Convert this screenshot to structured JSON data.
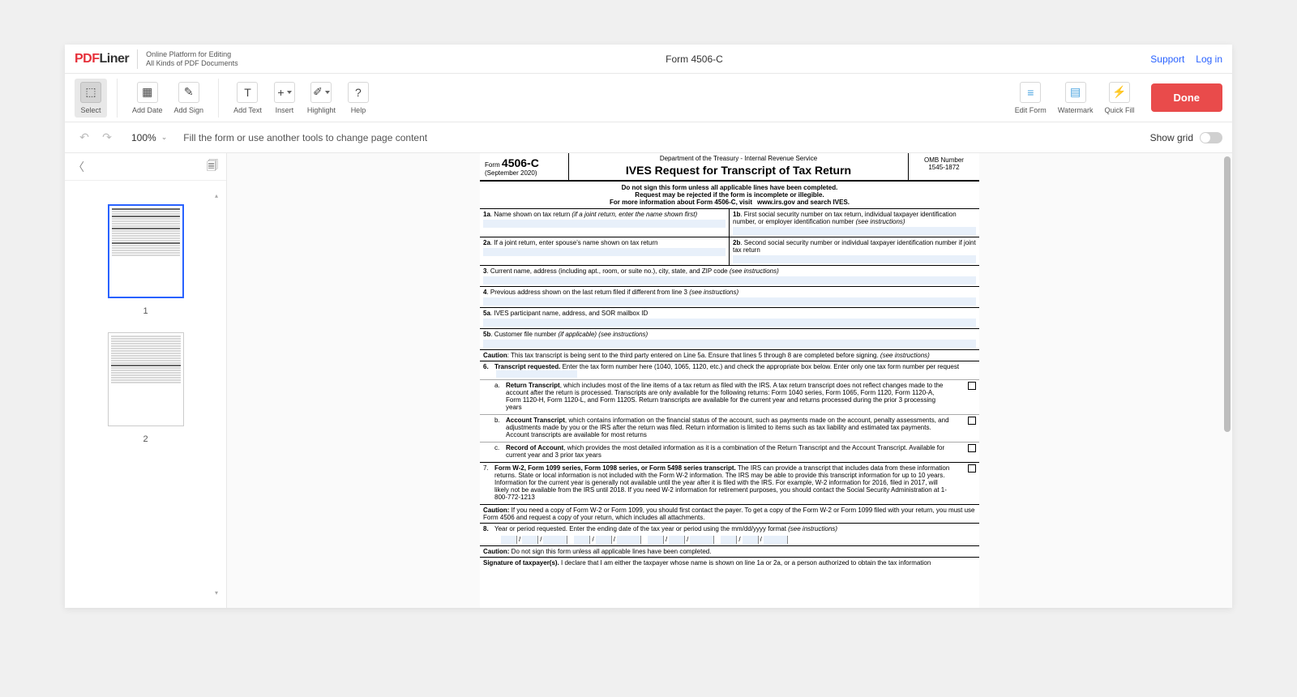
{
  "header": {
    "logo_pdf": "PDF",
    "logo_liner": "Liner",
    "tagline1": "Online Platform for Editing",
    "tagline2": "All Kinds of PDF Documents",
    "doc_title": "Form 4506-C",
    "support": "Support",
    "login": "Log in"
  },
  "toolbar": {
    "select": "Select",
    "add_date": "Add Date",
    "add_sign": "Add Sign",
    "add_text": "Add Text",
    "insert": "Insert",
    "highlight": "Highlight",
    "help": "Help",
    "edit_form": "Edit Form",
    "watermark": "Watermark",
    "quick_fill": "Quick Fill",
    "done": "Done"
  },
  "subbar": {
    "zoom": "100%",
    "hint": "Fill the form or use another tools to change page content",
    "show_grid": "Show grid"
  },
  "thumbs": {
    "page1": "1",
    "page2": "2"
  },
  "form": {
    "form_label": "Form",
    "form_number": "4506-C",
    "form_date": "(September 2020)",
    "dept": "Department of the Treasury - Internal Revenue Service",
    "title": "IVES Request for Transcript of Tax Return",
    "omb_label": "OMB Number",
    "omb_number": "1545-1872",
    "warn1": "Do not sign this form unless all applicable lines have been completed.",
    "warn2": "Request may be rejected if the form is incomplete or illegible.",
    "warn3_a": "For more information about Form 4506-C, visit",
    "warn3_b": "www.irs.gov and search IVES.",
    "row1a_label": "1a",
    "row1a_text": ". Name shown on tax return ",
    "row1a_italic": "(if a joint return, enter the name shown first)",
    "row1b_label": "1b",
    "row1b_text": ". First social security number on tax return, individual taxpayer identification number, or employer identification number ",
    "row1b_italic": "(see instructions)",
    "row2a_label": "2a",
    "row2a_text": ". If a joint return, enter spouse's name shown on tax return",
    "row2b_label": "2b",
    "row2b_text": ". Second social security number or individual taxpayer identification number if joint tax return",
    "row3_label": "3",
    "row3_text": ". Current name, address (including apt., room, or suite no.), city, state, and ZIP code ",
    "row3_italic": "(see instructions)",
    "row4_label": "4",
    "row4_text": ". Previous address shown on the last return filed if different from line 3 ",
    "row4_italic": "(see instructions)",
    "row5a_label": "5a",
    "row5a_text": ". IVES participant name, address, and SOR mailbox ID",
    "row5b_label": "5b",
    "row5b_text": ". Customer file number ",
    "row5b_italic": "(if applicable) (see instructions)",
    "caution1_label": "Caution",
    "caution1_text": ": This tax transcript is being sent to the third party entered on Line 5a. Ensure that lines 5 through 8 are completed before signing. ",
    "caution1_italic": "(see instructions)",
    "row6_num": "6.",
    "row6_bold": "Transcript requested.",
    "row6_text1": " Enter the tax form number here (1040, 1065, 1120, etc.) and check the appropriate box below. Enter only one tax form number per request",
    "row6a_letter": "a.",
    "row6a_bold": "Return Transcript",
    "row6a_text": ", which includes most of the line items of a tax return as filed with the IRS. A tax return transcript does not reflect changes made to the account after the return is processed. Transcripts are only available for the following returns: Form 1040 series, Form 1065, Form 1120, Form 1120-A, Form 1120-H, Form 1120-L, and Form 1120S. Return transcripts are available for the current year and returns processed during the prior 3 processing years",
    "row6b_letter": "b.",
    "row6b_bold": "Account Transcript",
    "row6b_text": ", which contains information on the financial status of the account, such as payments made on the account, penalty assessments, and adjustments made by you or the IRS after the return was filed. Return information is limited to items such as tax liability and estimated tax payments. Account transcripts are available for most returns",
    "row6c_letter": "c.",
    "row6c_bold": "Record of Account",
    "row6c_text": ", which provides the most detailed information as it is a combination of the Return Transcript and the Account Transcript. Available for current year and 3 prior tax years",
    "row7_num": "7.",
    "row7_bold": "Form W-2, Form 1099 series, Form 1098 series, or Form 5498 series transcript.",
    "row7_text": " The IRS can provide a transcript that includes data from these information returns. State or local information is not included with the Form W-2 information. The IRS may be able to provide this transcript information for up to 10 years. Information for the current year is generally not available until the year after it is filed with the IRS. For example, W-2 information for 2016, filed in 2017, will likely not be available from the IRS until 2018. If you need W-2 information for retirement purposes, you should contact the Social Security Administration at 1-800-772-1213",
    "caution2_label": "Caution:",
    "caution2_text": " If you need a copy of Form W-2 or Form 1099, you should first contact the payer. To get a copy of the Form W-2 or Form 1099 filed with your return, you must use Form 4506 and request a copy of your return, which includes all attachments.",
    "row8_num": "8.",
    "row8_text1": "Year or period requested. Enter the ending date of the tax year or period using the mm/dd/yyyy format ",
    "row8_italic": "(see instructions)",
    "caution3_label": "Caution:",
    "caution3_text": " Do not sign this form unless all applicable lines have been completed.",
    "sig_bold": "Signature of taxpayer(s).",
    "sig_text": " I declare that I am either the taxpayer whose name is shown on line 1a or 2a, or a person authorized to obtain the tax information"
  }
}
